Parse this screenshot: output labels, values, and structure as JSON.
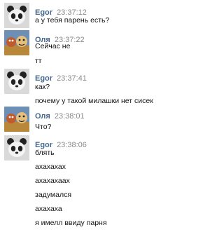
{
  "colors": {
    "name": "#45688e",
    "time": "#888888",
    "text": "#111111",
    "background": "#ffffff"
  },
  "messages": [
    {
      "author": "Egor",
      "time": "23:37:12",
      "avatar": "panda-avatar",
      "lines": [
        "а у тебя парень есть?"
      ]
    },
    {
      "author": "Оля",
      "time": "23:37:22",
      "avatar": "cartoon-avatar",
      "lines": [
        "Сейчас не",
        "тт"
      ]
    },
    {
      "author": "Egor",
      "time": "23:37:41",
      "avatar": "panda-avatar",
      "lines": [
        "как?",
        "почему у такой милашки нет сисек"
      ]
    },
    {
      "author": "Оля",
      "time": "23:38:01",
      "avatar": "cartoon-avatar",
      "lines": [
        "Что?"
      ]
    },
    {
      "author": "Egor",
      "time": "23:38:06",
      "avatar": "panda-avatar",
      "lines": [
        "блять",
        "ахахахах",
        "ахахахаах",
        "задумался",
        "ахахаха",
        "я имелл ввиду парня"
      ]
    }
  ]
}
